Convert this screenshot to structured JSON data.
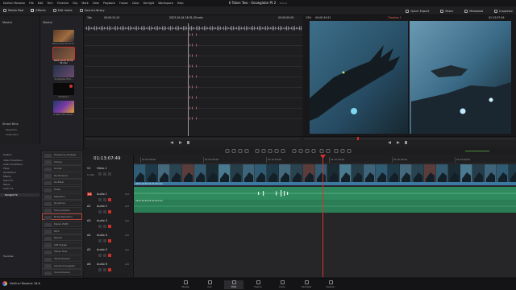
{
  "app": {
    "name": "DaVinci Resolve",
    "version_label": "DaVinci Resolve 18.6"
  },
  "menu": [
    "DaVinci Resolve",
    "File",
    "Edit",
    "Trim",
    "Timeline",
    "Clip",
    "Mark",
    "View",
    "Playback",
    "Fusion",
    "Color",
    "Fairlight",
    "Workspace",
    "Help"
  ],
  "project": {
    "title": "6 Takes Two - Snowglobe Pt 2",
    "status": "Edited"
  },
  "toolbar": {
    "media_pool": "Media Pool",
    "effects": "Effects",
    "edit_index": "Edit Index",
    "sound_library": "Sound Library",
    "quick_export": "Quick Export",
    "mixer": "Mixer",
    "metadata": "Metadata",
    "inspector": "Inspector"
  },
  "media_pool": {
    "sidebar_header": "Master",
    "bin_header": "Master",
    "clips": [
      {
        "label": "2023-10-04 18-31-0..."
      },
      {
        "label": "2023-10-04 18-31-05.mkv"
      },
      {
        "label": "Snowglobe Pts1..."
      },
      {
        "label": "Timeline 1"
      },
      {
        "label": "It Takes Two Snow..."
      }
    ],
    "smart_bins": {
      "header": "Smart Bins",
      "items": [
        "Keywords",
        "Collections"
      ]
    }
  },
  "source_viewer": {
    "zoom": "16x",
    "timecode_in": "00:00:24:15",
    "clip_name": "2023-10-04 18-31-05.mkv",
    "duration": "00:00:00:00"
  },
  "timeline_viewer": {
    "zoom": "13%",
    "timecode": "00:00:34:51",
    "timeline_name": "Timeline 1",
    "current_tc": "01:13:07:49"
  },
  "effects_panel": {
    "categories": [
      "Toolbox",
      "Video Transitions",
      "Audio Transitions",
      "Titles",
      "Generators",
      "Effects",
      "Open FX",
      "Filters",
      "Audio FX",
      "Fairlight FX"
    ],
    "selected_category": "Fairlight FX",
    "favorites_label": "Favorites",
    "items": [
      "Frequency Analyzer",
      "Chorus",
      "Limiter",
      "De-Hummer",
      "De-Esser",
      "Delay",
      "Distortion",
      "Dynamics",
      "Foley Sampler",
      "Noise Reduction",
      "Stereo Width",
      "Pitch",
      "Reverb",
      "Soft Clipper",
      "Stereo Fixer",
      "Vocal Channel",
      "Surround Analyzer",
      "Vocal Channel"
    ],
    "selected_item": "Noise Reduction"
  },
  "timeline": {
    "timecode": "01:13:07:49",
    "ruler_marks": [
      "01:00:00:00",
      "01:05:00:00",
      "01:10:00:00",
      "01:15:00:00",
      "01:20:00:00",
      "01:25:00:00"
    ],
    "tracks": [
      {
        "id": "V1",
        "name": "Video 1",
        "sub": "1 Clip"
      },
      {
        "id": "A1",
        "name": "Audio 1",
        "level": "2.0"
      },
      {
        "id": "A2",
        "name": "Audio 2",
        "level": "2.0"
      },
      {
        "id": "A3",
        "name": "Audio 3",
        "level": "2.0"
      },
      {
        "id": "A4",
        "name": "Audio 4",
        "level": "2.0"
      },
      {
        "id": "A5",
        "name": "Audio 5",
        "level": "2.0"
      },
      {
        "id": "A6",
        "name": "Audio 6",
        "level": "2.0"
      }
    ],
    "video_clip_label": "2023-10-04 18-31-05.mkv",
    "audio_clip_label": "2023-10-04 18-31-05.mkv"
  },
  "pages": [
    "Media",
    "Cut",
    "Edit",
    "Fusion",
    "Color",
    "Fairlight",
    "Deliver"
  ],
  "active_page": "Edit",
  "colors": {
    "playhead": "#d8302a",
    "video_clip": "#3c7aa3",
    "audio_clip": "#2f8a5e",
    "accent": "#c0392b"
  }
}
